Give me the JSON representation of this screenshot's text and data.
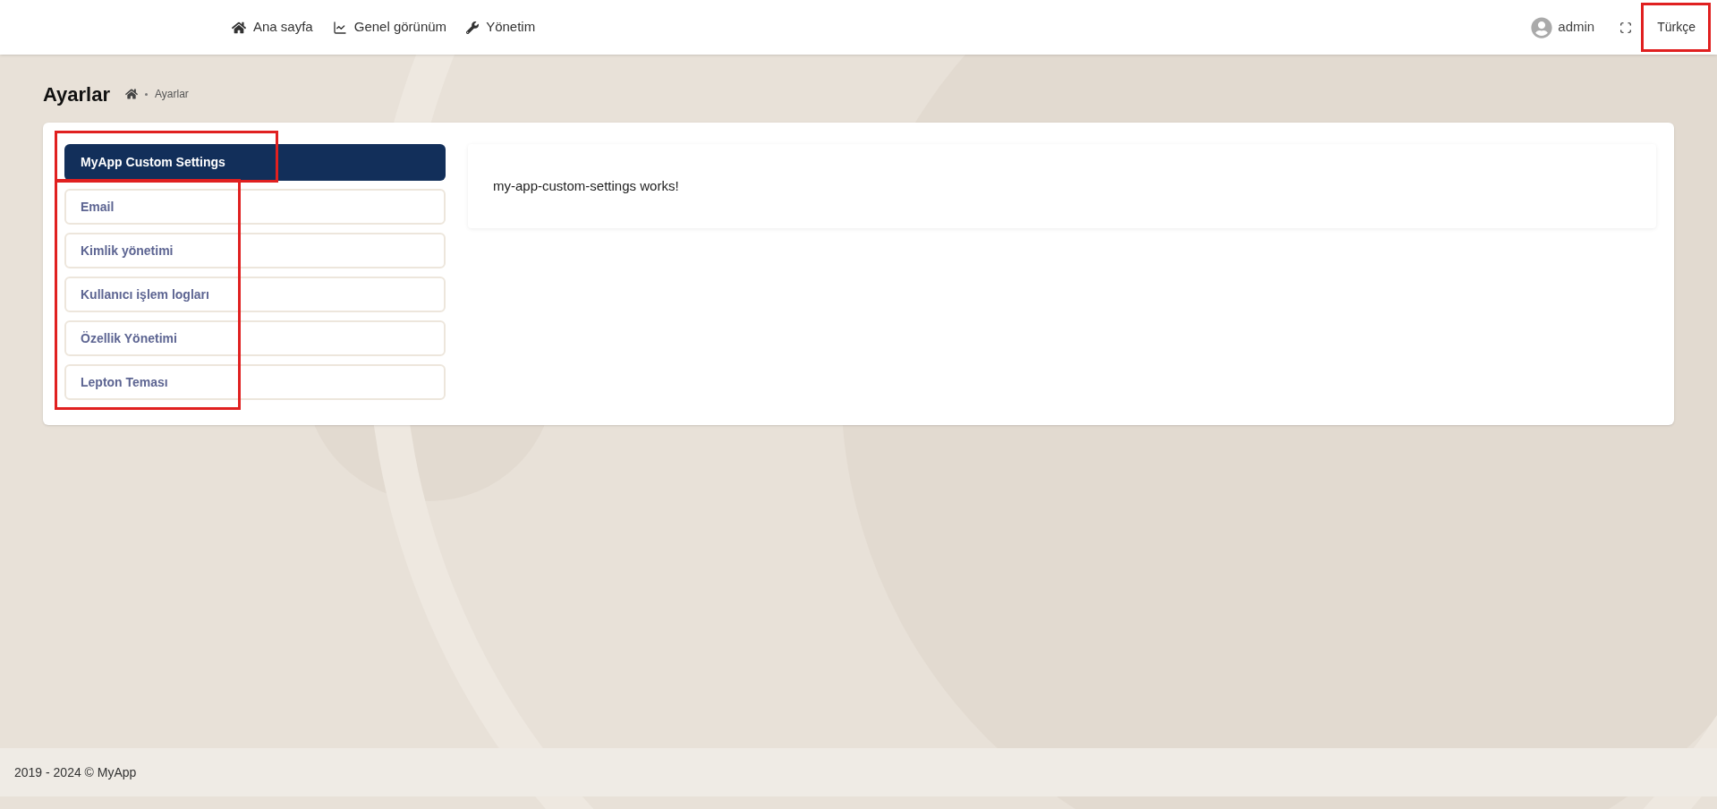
{
  "nav": {
    "links": [
      {
        "kind": "home",
        "label": "Ana sayfa"
      },
      {
        "kind": "chart",
        "label": "Genel görünüm"
      },
      {
        "kind": "wrench",
        "label": "Yönetim"
      }
    ],
    "user": "admin",
    "language": "Türkçe"
  },
  "page": {
    "title": "Ayarlar",
    "breadcrumb": [
      "Ayarlar"
    ]
  },
  "settings_tabs": [
    {
      "label": "MyApp Custom Settings",
      "selected": true
    },
    {
      "label": "Email",
      "selected": false
    },
    {
      "label": "Kimlik yönetimi",
      "selected": false
    },
    {
      "label": "Kullanıcı işlem logları",
      "selected": false
    },
    {
      "label": "Özellik Yönetimi",
      "selected": false
    },
    {
      "label": "Lepton Teması",
      "selected": false
    }
  ],
  "content": {
    "text": "my-app-custom-settings works!"
  },
  "footer": {
    "text": "2019 - 2024 © MyApp"
  }
}
